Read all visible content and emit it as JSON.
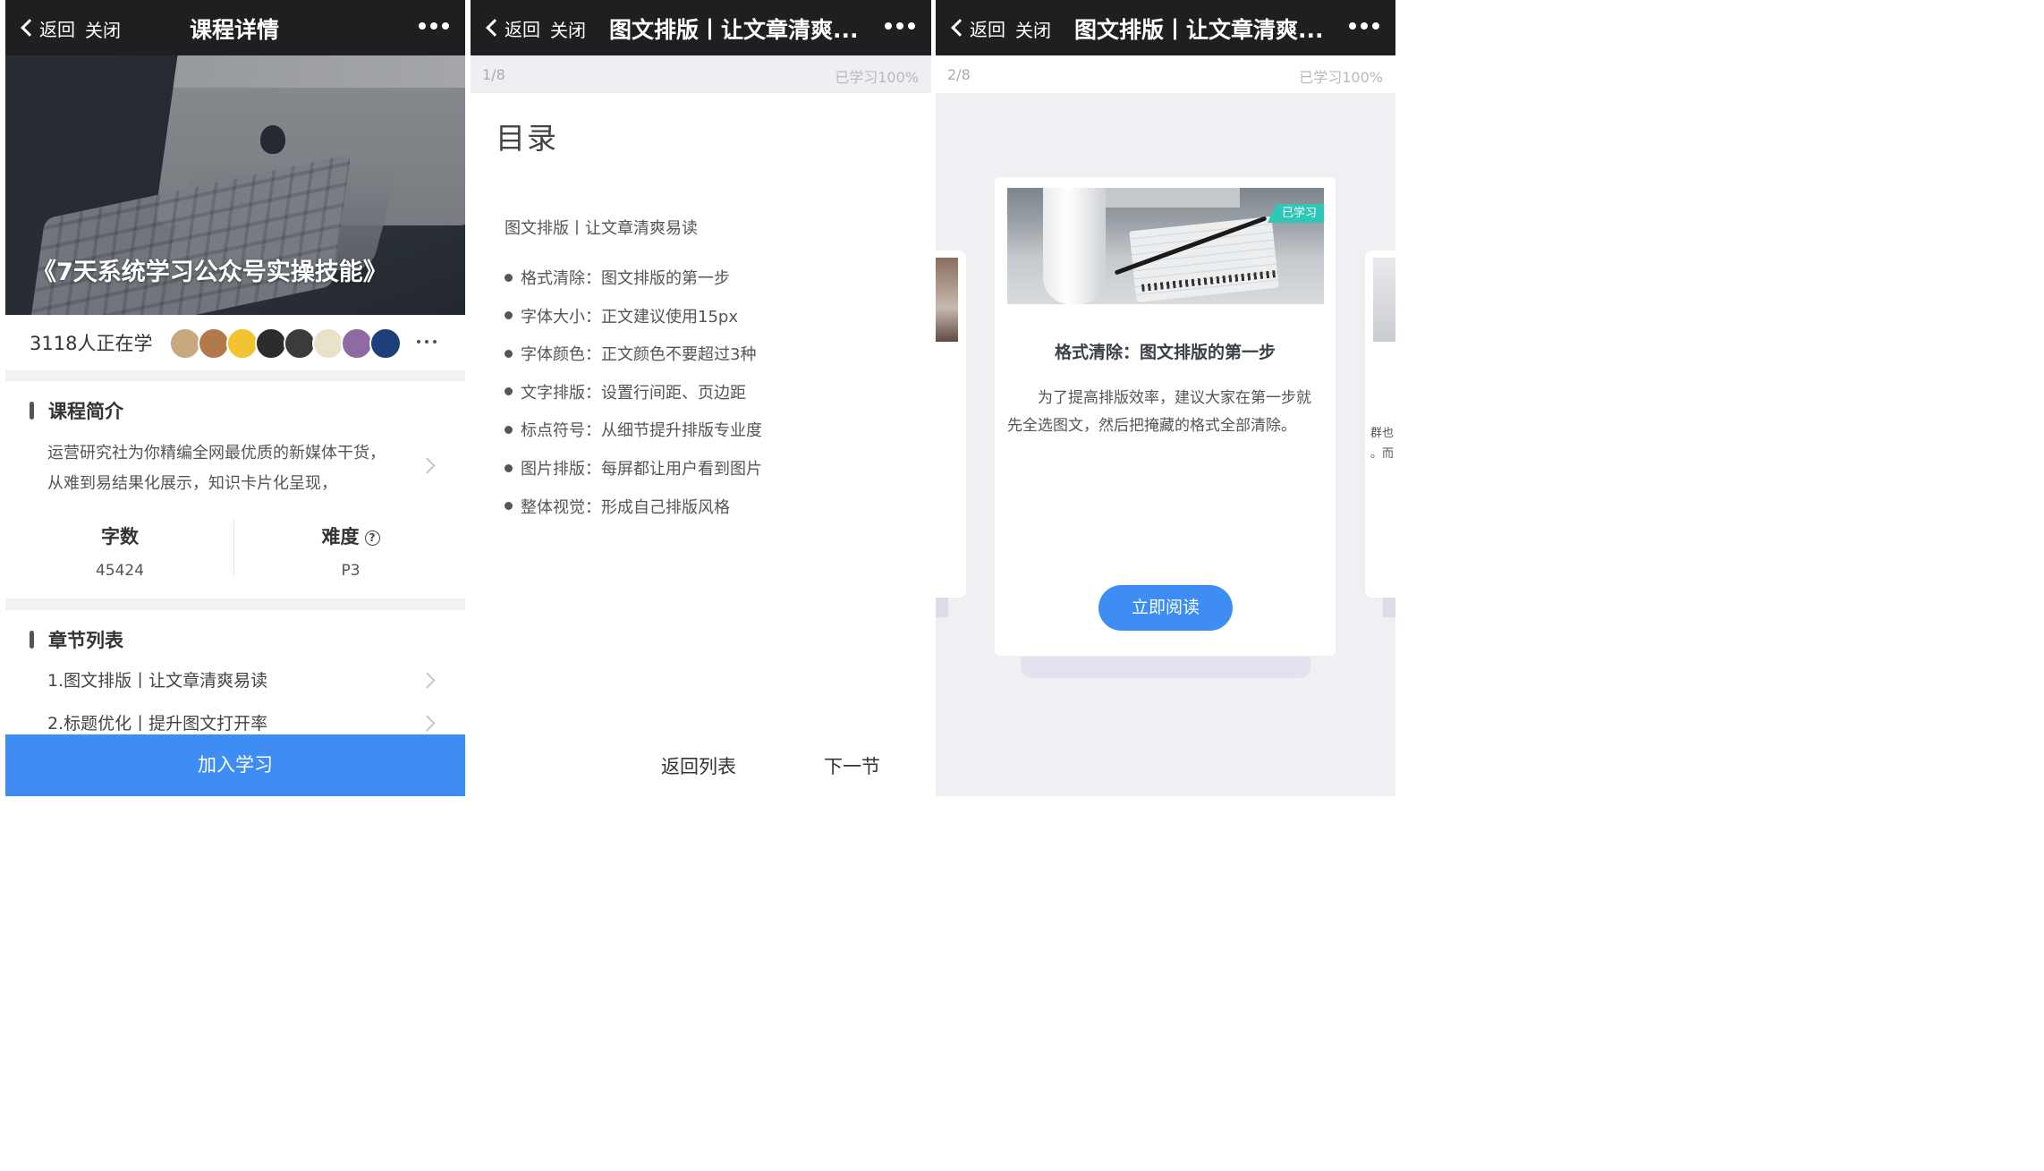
{
  "nav": {
    "back_label": "返回",
    "close_label": "关闭"
  },
  "screen1": {
    "title": "课程详情",
    "hero_title": "《7天系统学习公众号实操技能》",
    "learner_count": "3118人正在学",
    "avatar_colors": [
      "#c9a77f",
      "#b07a4a",
      "#f2c230",
      "#2c2c2c",
      "#3b3b3b",
      "#e8e2c9",
      "#8e6aa0",
      "#1f3f7a"
    ],
    "intro": {
      "heading": "课程简介",
      "text": "运营研究社为你精编全网最优质的新媒体干货，从难到易结果化展示，知识卡片化呈现，"
    },
    "stats": {
      "words_label": "字数",
      "words_value": "45424",
      "difficulty_label": "难度",
      "difficulty_value": "P3",
      "help_glyph": "?"
    },
    "chapters": {
      "heading": "章节列表",
      "items": [
        "1.图文排版丨让文章清爽易读",
        "2.标题优化丨提升图文打开率"
      ]
    },
    "join_button": "加入学习",
    "accent_color": "#3d8df5"
  },
  "screen2": {
    "title": "图文排版丨让文章清爽...",
    "page": "1/8",
    "progress": "已学习100%",
    "toc_title": "目录",
    "toc_subtitle": "图文排版丨让文章清爽易读",
    "toc_items": [
      "格式清除：图文排版的第一步",
      "字体大小：正文建议使用15px",
      "字体颜色：正文颜色不要超过3种",
      "文字排版：设置行间距、页边距",
      "标点符号：从细节提升排版专业度",
      "图片排版：每屏都让用户看到图片",
      "整体视觉：形成自己排版风格"
    ],
    "back_to_list": "返回列表",
    "next_section": "下一节"
  },
  "screen3": {
    "title": "图文排版丨让文章清爽...",
    "page": "2/8",
    "progress": "已学习100%",
    "card": {
      "badge": "已学习",
      "title": "格式清除：图文排版的第一步",
      "body": "为了提高排版效率，建议大家在第一步就先全选图文，然后把掩藏的格式全部清除。",
      "read_button": "立即阅读"
    },
    "peek_right_line1": "群也",
    "peek_right_line2": "。而",
    "badge_color": "#2fc7b7"
  }
}
